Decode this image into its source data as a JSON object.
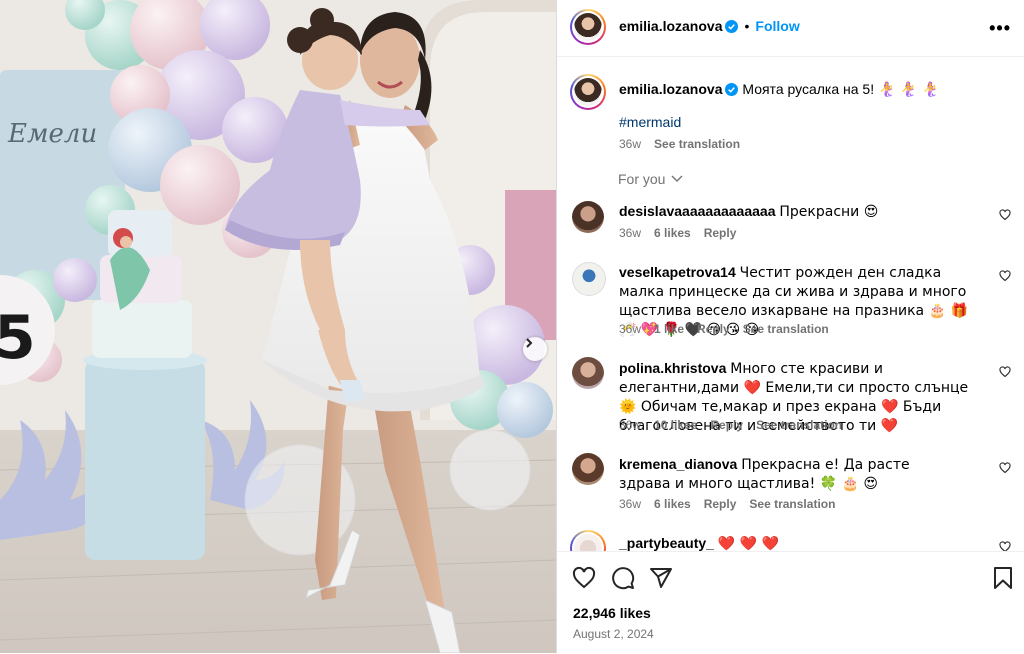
{
  "post": {
    "author": "emilia.lozanova",
    "follow_label": "Follow",
    "more_icon": "more-horizontal-icon",
    "caption_text": "Моята русалка на 5!",
    "caption_emoji": "🧜‍♀️ 🧜‍♀️ 🧜‍♀️",
    "hashtag": "#mermaid",
    "caption_time": "36w",
    "see_translation": "See translation",
    "likes": "22,946 likes",
    "date": "August 2, 2024"
  },
  "photo": {
    "wall_name": "Емели",
    "cake_number": "5"
  },
  "for_you": "For you",
  "comments": [
    {
      "user": "desislavaaaaaaaaaaaaa",
      "text": "Прекрасни 😍",
      "time": "36w",
      "likes": "6 likes",
      "reply": "Reply",
      "translate": ""
    },
    {
      "user": "veselkapetrova14",
      "text": "Честит рожден ден сладка малка принцеске да си жива и здрава и много щастлива весело изкарване на празника 🎂 🎁 🥂 💖 🌹 🖤 😘 😘 😘",
      "time": "36w",
      "likes": "1 like",
      "reply": "Reply",
      "translate": "See translation"
    },
    {
      "user": "polina.khristova",
      "text": "Много сте красиви и елегантни,дами ❤️ Емели,ти си просто слънце 🌞 Обичам те,макар и през екрана ❤️ Бъди благословена ти и семейството ти ❤️",
      "time": "36w",
      "likes": "10 likes",
      "reply": "Reply",
      "translate": "See translation"
    },
    {
      "user": "kremena_dianova",
      "text": "Прекрасна е! Да расте здрава и много щастлива! 🍀 🎂 😍",
      "time": "36w",
      "likes": "6 likes",
      "reply": "Reply",
      "translate": "See translation"
    },
    {
      "user": "_partybeauty_",
      "text": "❤️ ❤️ ❤️",
      "time": "",
      "likes": "",
      "reply": "",
      "translate": ""
    }
  ],
  "actions": {
    "like_icon": "heart-icon",
    "comment_icon": "comment-icon",
    "share_icon": "share-icon",
    "save_icon": "bookmark-icon"
  },
  "colors": {
    "follow": "#0095f6",
    "meta": "#737373",
    "like_red": "#e4123d"
  }
}
